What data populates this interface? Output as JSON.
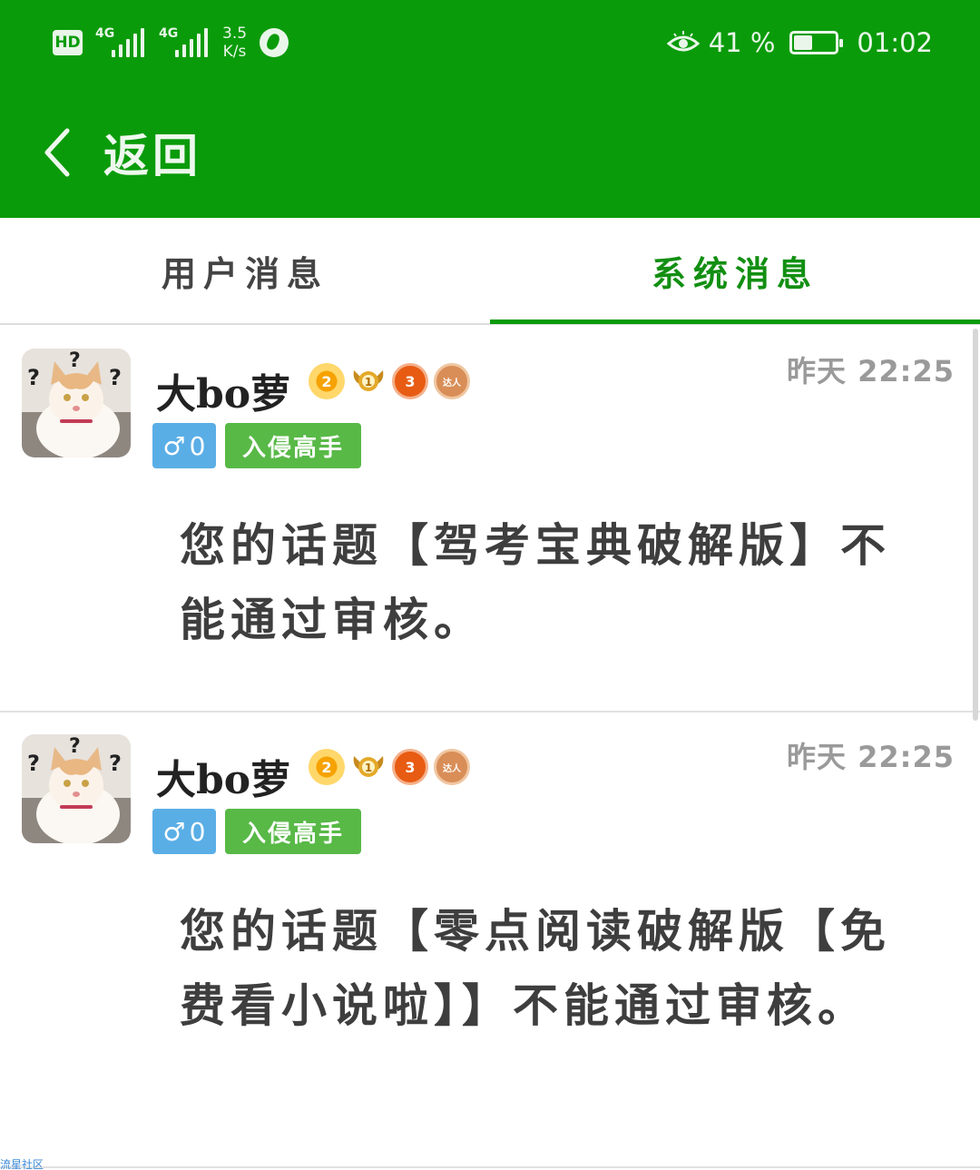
{
  "status_bar": {
    "hd": "HD",
    "sim1_label": "4G",
    "sim2_label": "4G",
    "speed_value": "3.5",
    "speed_unit": "K/s",
    "battery_text": "41 %",
    "battery_level": 0.41,
    "time": "01:02"
  },
  "nav": {
    "back_label": "返回"
  },
  "tabs": [
    {
      "label": "用户消息",
      "active": false
    },
    {
      "label": "系统消息",
      "active": true
    }
  ],
  "messages": [
    {
      "user": "大bo萝",
      "time": "昨天 22:25",
      "gender_symbol": "♂",
      "gender_count": "0",
      "badges": [
        "2",
        "1",
        "3",
        "达人"
      ],
      "rank": "入侵高手",
      "text": "您的话题【驾考宝典破解版】不能通过审核。"
    },
    {
      "user": "大bo萝",
      "time": "昨天 22:25",
      "gender_symbol": "♂",
      "gender_count": "0",
      "badges": [
        "2",
        "1",
        "3",
        "达人"
      ],
      "rank": "入侵高手",
      "text": "您的话题【零点阅读破解版【免费看小说啦】】不能通过审核。"
    }
  ],
  "watermark": "流星社区",
  "colors": {
    "header": "#0a9b0a",
    "tab_active": "#128f12",
    "gender_tag": "#5aaee6",
    "rank_tag": "#58b947"
  }
}
